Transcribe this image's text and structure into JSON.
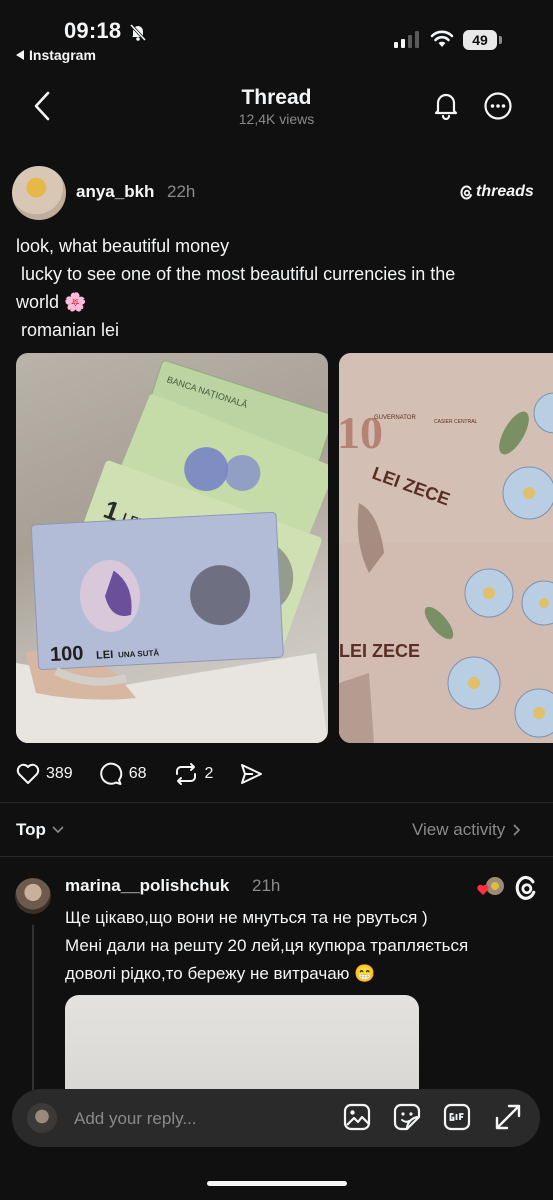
{
  "status_bar": {
    "time": "09:18",
    "back_app_label": "Instagram",
    "battery": "49"
  },
  "header": {
    "title": "Thread",
    "views": "12,4K views"
  },
  "post": {
    "username": "anya_bkh",
    "time": "22h",
    "brand": "threads",
    "text_lines": [
      "look, what beautiful money",
      " lucky to see one of the most beautiful currencies in the",
      "world 🌸",
      " romanian lei"
    ],
    "image1": {
      "note_top": "BANCA NAȚIONALĂ",
      "note_1": "1",
      "note_1_unit": "LEU",
      "note_100": "100",
      "note_100_unit": "LEI",
      "note_100_text": "UNA SUTĂ"
    },
    "image2": {
      "note_value": "10",
      "note_text": "LEI ZECE",
      "note_text_2": "LEI ZECE",
      "label_guvernator": "GUVERNATOR",
      "label_casier": "CASIER CENTRAL"
    },
    "likes": "389",
    "comments": "68",
    "reposts": "2"
  },
  "sort": {
    "label": "Top",
    "view_activity": "View activity"
  },
  "reply": {
    "username": "marina__polishchuk",
    "time": "21h",
    "text_lines": [
      "Ще цікаво,що вони не мнуться та не рвуться )",
      "Мені дали на решту 20 лей,ця купюра трапляється",
      "доволі рідко,то бережу не витрачаю 😁"
    ]
  },
  "reply_bar": {
    "placeholder": "Add your reply..."
  },
  "icons": {
    "back": "chevron-left-icon",
    "notification": "bell-icon",
    "more": "more-icon",
    "like": "heart-icon",
    "comment": "comment-icon",
    "repost": "repost-icon",
    "share": "send-icon",
    "gallery": "image-icon",
    "sticker": "sticker-icon",
    "gif": "gif-icon",
    "expand": "expand-icon"
  },
  "colors": {
    "background": "#101010",
    "text": "#f3f5f7",
    "secondary_text": "#8a8a8a",
    "heart_accent": "#ff3040"
  }
}
